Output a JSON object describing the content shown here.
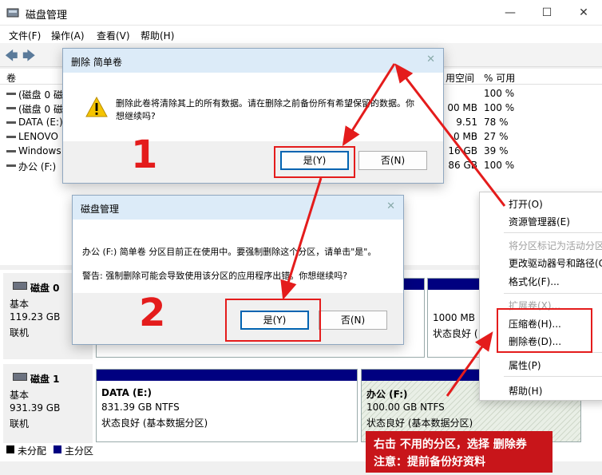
{
  "window": {
    "title": "磁盘管理",
    "minimize": "—",
    "maximize": "☐",
    "close": "✕"
  },
  "menu": [
    "文件(F)",
    "操作(A)",
    "查看(V)",
    "帮助(H)"
  ],
  "volume_list": {
    "columns": {
      "volume": "卷",
      "free": "用空间",
      "pct": "% 可用"
    },
    "rows": [
      {
        "name": "(磁盘 0 磁",
        "free": "",
        "pct": "100 %"
      },
      {
        "name": "(磁盘 0 磁",
        "free": "00 MB",
        "pct": "100 %"
      },
      {
        "name": "DATA (E:)",
        "free": "9.51 ...",
        "pct": "78 %"
      },
      {
        "name": "LENOVO",
        "free": "0 MB",
        "pct": "27 %"
      },
      {
        "name": "Windows",
        "free": "16 GB",
        "pct": "39 %"
      },
      {
        "name": "办公 (F:)",
        "free": "86 GB",
        "pct": "100 %"
      }
    ]
  },
  "disks": [
    {
      "name": "磁盘 0",
      "type": "基本",
      "size": "119.23 GB",
      "status": "联机",
      "partitions": [
        {
          "size": "1000 MB",
          "status": "状态良好 ("
        }
      ]
    },
    {
      "name": "磁盘 1",
      "type": "基本",
      "size": "931.39 GB",
      "status": "联机",
      "partitions": [
        {
          "label": "DATA  (E:)",
          "size": "831.39 GB NTFS",
          "status": "状态良好 (基本数据分区)"
        },
        {
          "label": "办公  (F:)",
          "size": "100.00 GB NTFS",
          "status": "状态良好 (基本数据分区)"
        }
      ]
    }
  ],
  "legend": {
    "unallocated": "未分配",
    "primary": "主分区",
    "unallocated_color": "#000000",
    "primary_color": "#000080"
  },
  "dialog1": {
    "title": "删除 简单卷",
    "message_line1": "删除此卷将清除其上的所有数据。请在删除之前备份所有希望保留的数据。你",
    "message_line2": "想继续吗?",
    "yes": "是(Y)",
    "no": "否(N)"
  },
  "dialog2": {
    "title": "磁盘管理",
    "message": "办公 (F:) 简单卷 分区目前正在使用中。要强制删除这个分区，请单击\"是\"。",
    "warning": "警告: 强制删除可能会导致使用该分区的应用程序出错。你想继续吗?",
    "yes": "是(Y)",
    "no": "否(N)"
  },
  "context_menu": [
    {
      "label": "打开(O)",
      "enabled": true
    },
    {
      "label": "资源管理器(E)",
      "enabled": true
    },
    {
      "label": "将分区标记为活动分区",
      "enabled": false
    },
    {
      "label": "更改驱动器号和路径(C",
      "enabled": true
    },
    {
      "label": "格式化(F)...",
      "enabled": true
    },
    {
      "label": "扩展卷(X)...",
      "enabled": false
    },
    {
      "label": "压缩卷(H)...",
      "enabled": true
    },
    {
      "label": "删除卷(D)...",
      "enabled": true
    },
    {
      "label": "属性(P)",
      "enabled": true
    },
    {
      "label": "帮助(H)",
      "enabled": true
    }
  ],
  "annotations": {
    "step1": "1",
    "step2": "2",
    "note_line1": "右击 不用的分区，选择  删除券",
    "note_line2": "注意：提前备份好资料",
    "color": "#e41c1c"
  }
}
